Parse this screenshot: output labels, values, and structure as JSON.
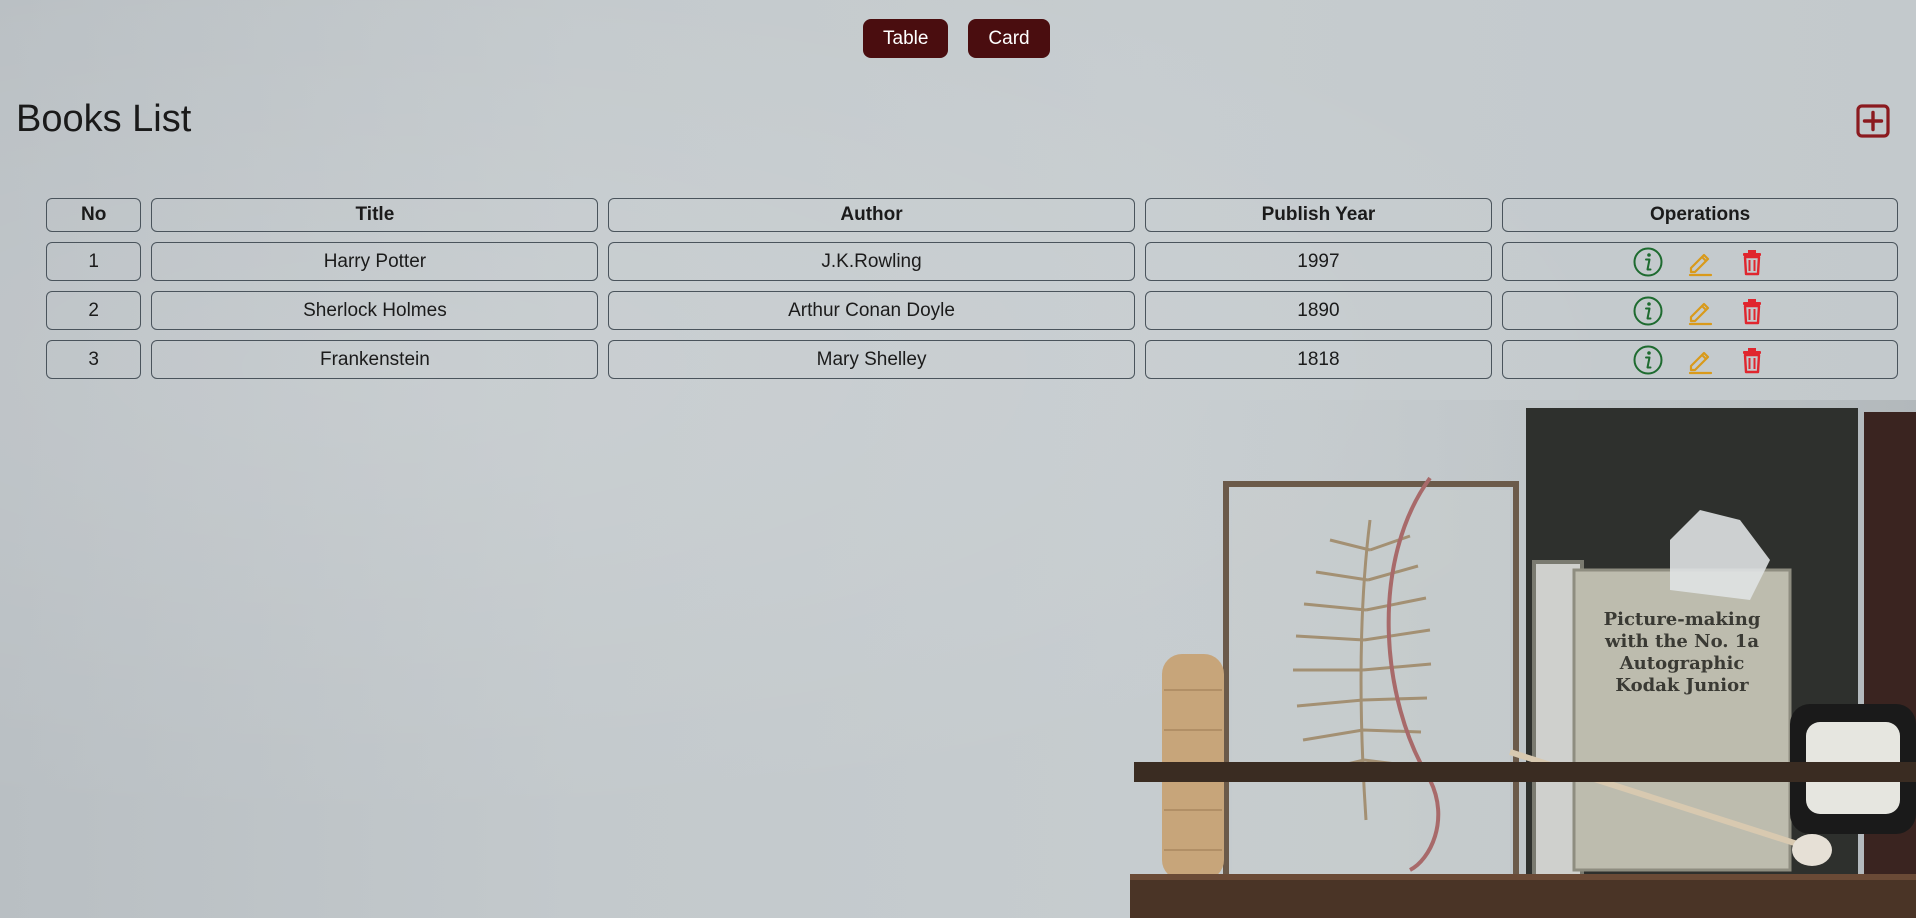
{
  "toggle": {
    "table_label": "Table",
    "card_label": "Card"
  },
  "page": {
    "title": "Books List"
  },
  "table": {
    "headers": [
      "No",
      "Title",
      "Author",
      "Publish Year",
      "Operations"
    ],
    "rows": [
      {
        "no": "1",
        "title": "Harry Potter",
        "author": "J.K.Rowling",
        "year": "1997"
      },
      {
        "no": "2",
        "title": "Sherlock Holmes",
        "author": "Arthur Conan Doyle",
        "year": "1890"
      },
      {
        "no": "3",
        "title": "Frankenstein",
        "author": "Mary Shelley",
        "year": "1818"
      }
    ]
  },
  "icons": {
    "add": "plus-square-icon",
    "info": "info-circle-icon",
    "edit": "pencil-icon",
    "delete": "trash-icon"
  },
  "colors": {
    "button_bg": "#4a0d0f",
    "add_icon": "#8b1a1f",
    "info_icon": "#1e6b30",
    "edit_icon": "#d99a1b",
    "delete_icon": "#e0262e"
  },
  "background": {
    "book_cover_text": "Picture-making with the No. 1a Autographic Kodak Junior"
  }
}
